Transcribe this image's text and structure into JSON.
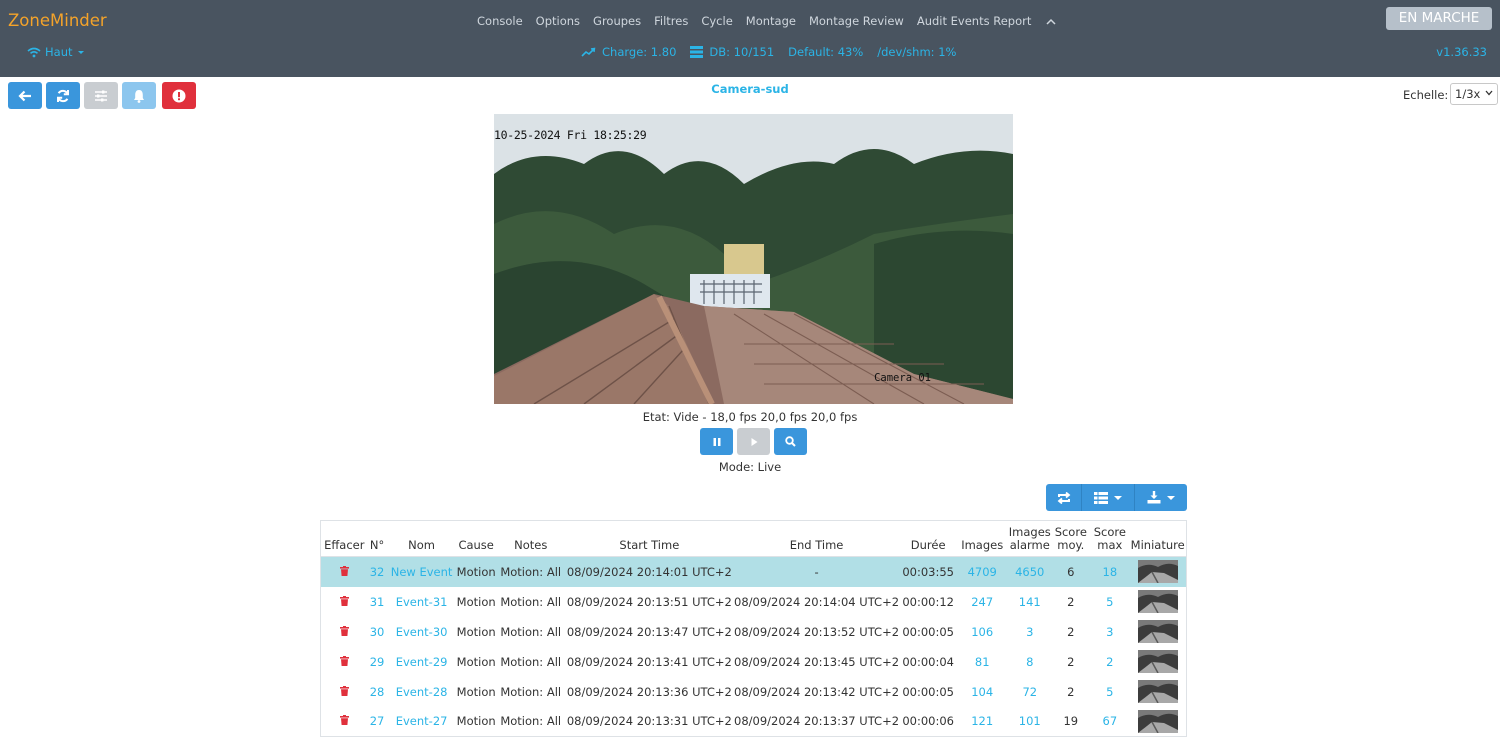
{
  "brand": "ZoneMinder",
  "menu": [
    "Console",
    "Options",
    "Groupes",
    "Filtres",
    "Cycle",
    "Montage",
    "Montage Review",
    "Audit Events Report"
  ],
  "status_button": "EN MARCHE",
  "bandwidth": "Haut",
  "stats": {
    "load": "Charge: 1.80",
    "db": "DB: 10/151",
    "default": "Default: 43%",
    "shm": "/dev/shm: 1%"
  },
  "version": "v1.36.33",
  "monitor": {
    "name": "Camera-sud",
    "scale_label": "Echelle:",
    "scale_value": "1/3x",
    "osd_time": "10-25-2024 Fri 18:25:29",
    "osd_cam": "Camera 01",
    "status": "Etat: Vide - 18,0 fps 20,0 fps 20,0 fps",
    "mode": "Mode: Live"
  },
  "table": {
    "headers": {
      "delete": "Effacer",
      "id": "N°",
      "name": "Nom",
      "cause": "Cause",
      "notes": "Notes",
      "start": "Start Time",
      "end": "End Time",
      "duration": "Durée",
      "frames": "Images",
      "alarm_frames_1": "Images",
      "alarm_frames_2": "alarme",
      "avg_1": "Score",
      "avg_2": "moy.",
      "max_1": "Score",
      "max_2": "max",
      "thumb": "Miniature"
    },
    "rows": [
      {
        "id": "32",
        "name": "New Event",
        "cause": "Motion",
        "notes": "Motion: All",
        "start": "08/09/2024 20:14:01 UTC+2",
        "end": "-",
        "duration": "00:03:55",
        "frames": "4709",
        "alarm": "4650",
        "avg": "6",
        "max": "18"
      },
      {
        "id": "31",
        "name": "Event-31",
        "cause": "Motion",
        "notes": "Motion: All",
        "start": "08/09/2024 20:13:51 UTC+2",
        "end": "08/09/2024 20:14:04 UTC+2",
        "duration": "00:00:12",
        "frames": "247",
        "alarm": "141",
        "avg": "2",
        "max": "5"
      },
      {
        "id": "30",
        "name": "Event-30",
        "cause": "Motion",
        "notes": "Motion: All",
        "start": "08/09/2024 20:13:47 UTC+2",
        "end": "08/09/2024 20:13:52 UTC+2",
        "duration": "00:00:05",
        "frames": "106",
        "alarm": "3",
        "avg": "2",
        "max": "3"
      },
      {
        "id": "29",
        "name": "Event-29",
        "cause": "Motion",
        "notes": "Motion: All",
        "start": "08/09/2024 20:13:41 UTC+2",
        "end": "08/09/2024 20:13:45 UTC+2",
        "duration": "00:00:04",
        "frames": "81",
        "alarm": "8",
        "avg": "2",
        "max": "2"
      },
      {
        "id": "28",
        "name": "Event-28",
        "cause": "Motion",
        "notes": "Motion: All",
        "start": "08/09/2024 20:13:36 UTC+2",
        "end": "08/09/2024 20:13:42 UTC+2",
        "duration": "00:00:05",
        "frames": "104",
        "alarm": "72",
        "avg": "2",
        "max": "5"
      },
      {
        "id": "27",
        "name": "Event-27",
        "cause": "Motion",
        "notes": "Motion: All",
        "start": "08/09/2024 20:13:31 UTC+2",
        "end": "08/09/2024 20:13:37 UTC+2",
        "duration": "00:00:06",
        "frames": "121",
        "alarm": "101",
        "avg": "19",
        "max": "67"
      }
    ]
  },
  "colors": {
    "topbar": "#495460",
    "brand": "#f4a32a",
    "accent": "#2bb4e6",
    "primary_button": "#3a96dc",
    "danger_button": "#e0303c",
    "selected_row": "#b1dfe6"
  },
  "icons": [
    "wifi-icon",
    "chart-line-icon",
    "database-icon",
    "arrow-left-icon",
    "refresh-icon",
    "sliders-icon",
    "bell-icon",
    "alert-icon",
    "pause-icon",
    "play-icon",
    "zoom-icon",
    "sync-icon",
    "columns-icon",
    "download-icon",
    "trash-icon"
  ]
}
